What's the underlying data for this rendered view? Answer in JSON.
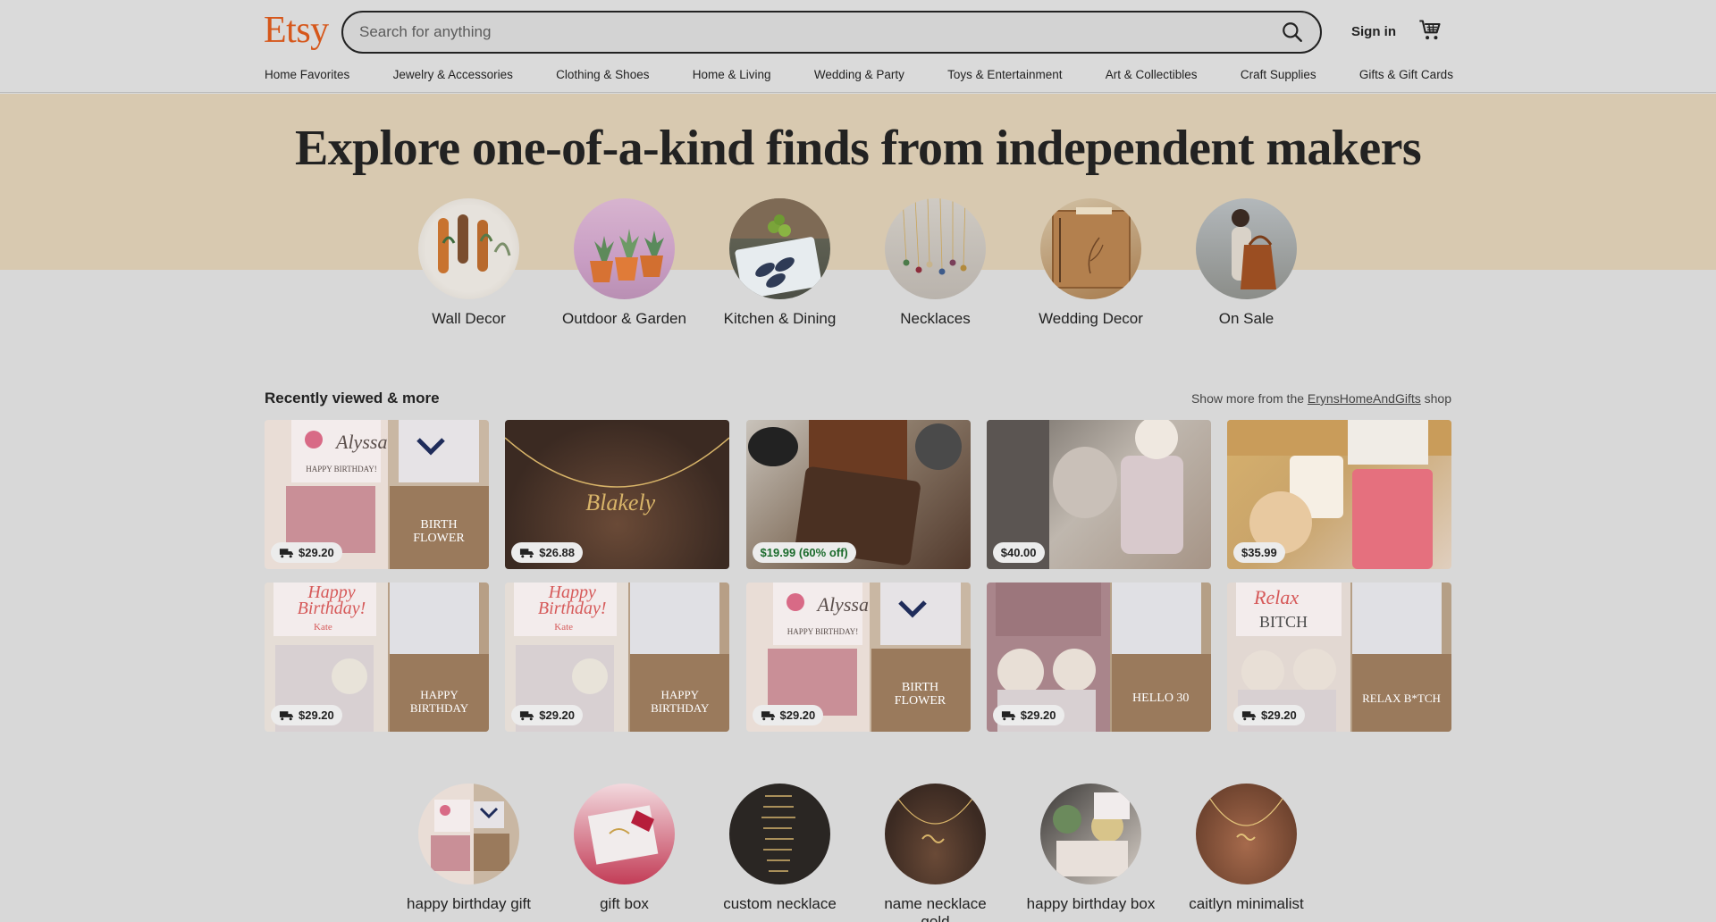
{
  "header": {
    "logo": "Etsy",
    "search_placeholder": "Search for anything",
    "sign_in": "Sign in"
  },
  "categories": [
    "Home Favorites",
    "Jewelry & Accessories",
    "Clothing & Shoes",
    "Home & Living",
    "Wedding & Party",
    "Toys & Entertainment",
    "Art & Collectibles",
    "Craft Supplies",
    "Gifts & Gift Cards"
  ],
  "hero": {
    "title": "Explore one-of-a-kind finds from independent makers",
    "circles": [
      {
        "label": "Wall Decor"
      },
      {
        "label": "Outdoor & Garden"
      },
      {
        "label": "Kitchen & Dining"
      },
      {
        "label": "Necklaces"
      },
      {
        "label": "Wedding Decor"
      },
      {
        "label": "On Sale"
      }
    ]
  },
  "recently_viewed": {
    "title": "Recently viewed & more",
    "more_prefix": "Show more from the",
    "shop_name": "ErynsHomeAndGifts",
    "more_suffix": "shop",
    "items": [
      {
        "price": "$29.20",
        "shipping": true,
        "sale": false
      },
      {
        "price": "$26.88",
        "shipping": true,
        "sale": false
      },
      {
        "price": "$19.99 (60% off)",
        "shipping": false,
        "sale": true
      },
      {
        "price": "$40.00",
        "shipping": false,
        "sale": false
      },
      {
        "price": "$35.99",
        "shipping": false,
        "sale": false
      },
      {
        "price": "$29.20",
        "shipping": true,
        "sale": false
      },
      {
        "price": "$29.20",
        "shipping": true,
        "sale": false
      },
      {
        "price": "$29.20",
        "shipping": true,
        "sale": false
      },
      {
        "price": "$29.20",
        "shipping": true,
        "sale": false
      },
      {
        "price": "$29.20",
        "shipping": true,
        "sale": false
      }
    ],
    "image_text": {
      "alyssa": "Alyssa",
      "happy_birthday": "HAPPY BIRTHDAY!",
      "birth_flower": "BIRTH FLOWER",
      "happy_birthday_box": "HAPPY BIRTHDAY",
      "hello_30": "HELLO 30",
      "relax": "RELAX B*TCH",
      "relax_script": "Relax",
      "bitch": "BITCH",
      "kate": "Kate",
      "happy_script": "Happy Birthday!",
      "name_script": "Blakely"
    }
  },
  "searches": {
    "circles": [
      {
        "label": "happy birthday gift"
      },
      {
        "label": "gift box"
      },
      {
        "label": "custom necklace"
      },
      {
        "label": "name necklace gold"
      },
      {
        "label": "happy birthday box"
      },
      {
        "label": "caitlyn minimalist"
      }
    ]
  },
  "colors": {
    "brand": "#d6571b",
    "hero_band": "#d8c9b0",
    "page_bg": "#d8d8d8",
    "sale_text": "#1b6b2c"
  }
}
